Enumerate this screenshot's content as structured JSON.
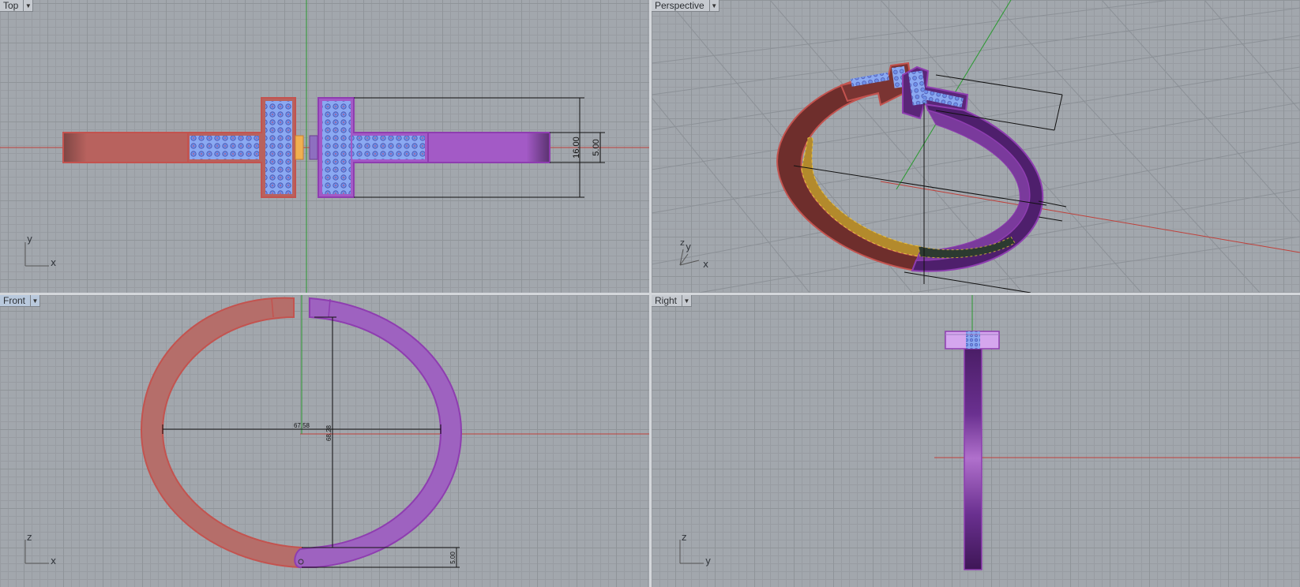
{
  "viewports": {
    "top": {
      "label": "Top",
      "axes": [
        "y",
        "x"
      ],
      "dims": [
        "16.00",
        "5.00"
      ]
    },
    "perspective": {
      "label": "Perspective",
      "axes": [
        "z",
        "y",
        "x"
      ]
    },
    "front": {
      "label": "Front",
      "axes": [
        "z",
        "x"
      ],
      "dims": [
        "67.58",
        "68.28",
        "5.00"
      ]
    },
    "right": {
      "label": "Right",
      "axes": [
        "z",
        "y"
      ]
    }
  },
  "colors": {
    "red_part": "#c3534f",
    "purple_part": "#8e3db0",
    "gem": "#7fa2f0",
    "x_axis": "#c0403a",
    "y_axis": "#2a9a30"
  },
  "icons": {
    "dropdown": "chevron-down-icon"
  }
}
